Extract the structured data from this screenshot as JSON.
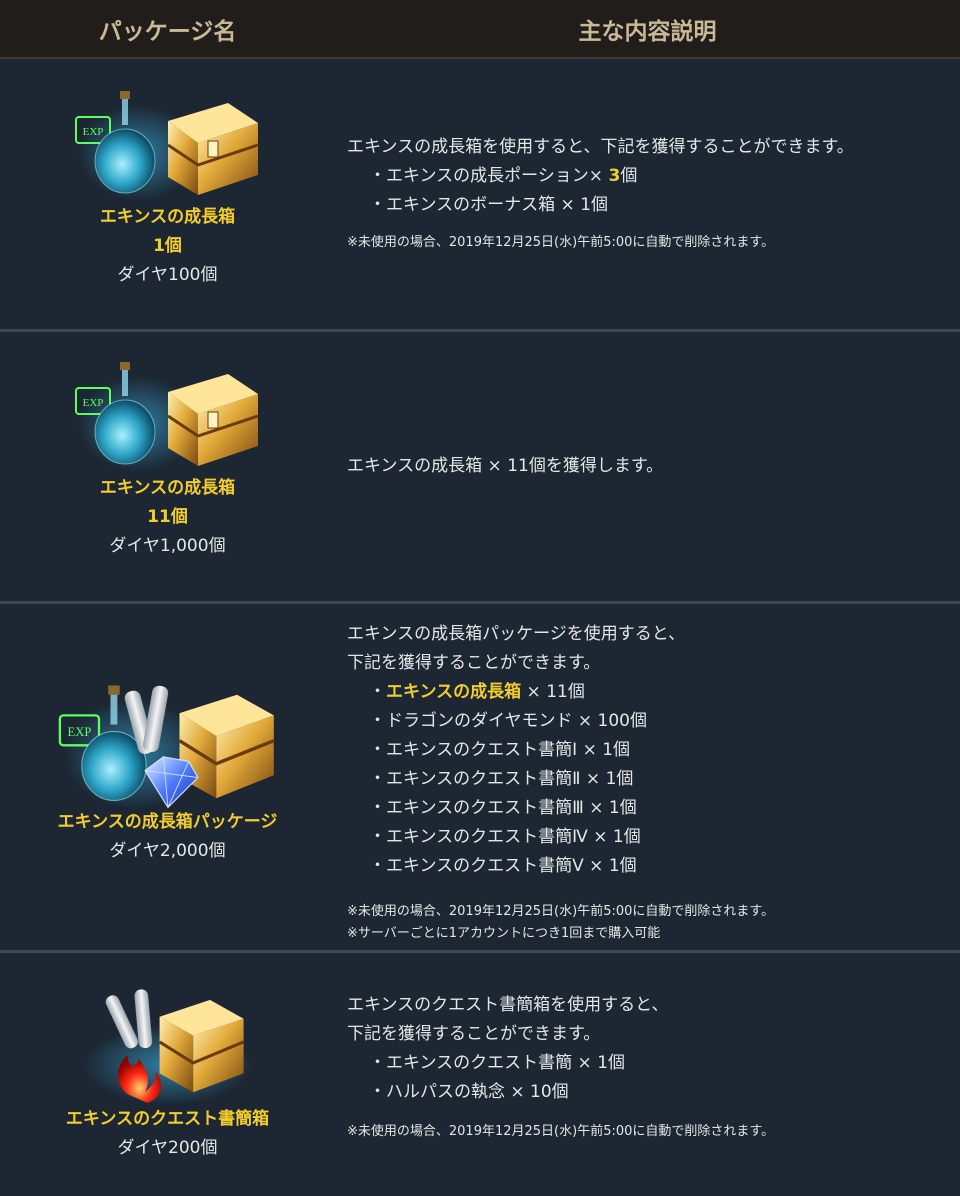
{
  "header": {
    "col1": "パッケージ名",
    "col2": "主な内容説明"
  },
  "rows": [
    {
      "name": "エキンスの成長箱",
      "qty": "1個",
      "price": "ダイヤ100個",
      "intro": "エキンスの成長箱を使用すると、下記を獲得することができます。",
      "items": [
        {
          "pre": "・エキンスの成長ポーション×",
          "num": "3",
          "post": "個"
        },
        {
          "text": "・エキンスのボーナス箱 × 1個"
        }
      ],
      "note": "※未使用の場合、2019年12月25日(水)午前5:00に自動で削除されます。",
      "icons": [
        "exp-potion-icon",
        "golden-chest-icon"
      ]
    },
    {
      "name": "エキンスの成長箱",
      "qty": "11個",
      "price": "ダイヤ1,000個",
      "text": "エキンスの成長箱 × 11個を獲得します。",
      "icons": [
        "exp-potion-icon",
        "golden-chest-icon"
      ]
    },
    {
      "name": "エキンスの成長箱パッケージ",
      "price": "ダイヤ2,000個",
      "intro1": "エキンスの成長箱パッケージを使用すると、",
      "intro2": "下記を獲得することができます。",
      "items": [
        {
          "hl": "エキンスの成長箱",
          "post": " × 11個"
        },
        {
          "text": "・ドラゴンのダイヤモンド × 100個"
        },
        {
          "text": "・エキンスのクエスト書簡Ⅰ × 1個"
        },
        {
          "text": "・エキンスのクエスト書簡Ⅱ × 1個"
        },
        {
          "text": "・エキンスのクエスト書簡Ⅲ × 1個"
        },
        {
          "text": "・エキンスのクエスト書簡Ⅳ × 1個"
        },
        {
          "text": "・エキンスのクエスト書簡Ⅴ × 1個"
        }
      ],
      "note1": "※未使用の場合、2019年12月25日(水)午前5:00に自動で削除されます。",
      "note2": "※サーバーごとに1アカウントにつき1回まで購入可能",
      "icons": [
        "exp-potion-icon",
        "scroll-icon",
        "diamond-icon",
        "golden-chest-icon"
      ]
    },
    {
      "name": "エキンスのクエスト書簡箱",
      "price": "ダイヤ200個",
      "intro1": "エキンスのクエスト書簡箱を使用すると、",
      "intro2": "下記を獲得することができます。",
      "items": [
        {
          "text": "・エキンスのクエスト書簡 × 1個"
        },
        {
          "text": "・ハルパスの執念 × 10個"
        }
      ],
      "note": "※未使用の場合、2019年12月25日(水)午前5:00に自動で削除されます。",
      "icons": [
        "scroll-icon",
        "flame-icon",
        "golden-chest-icon"
      ]
    }
  ]
}
